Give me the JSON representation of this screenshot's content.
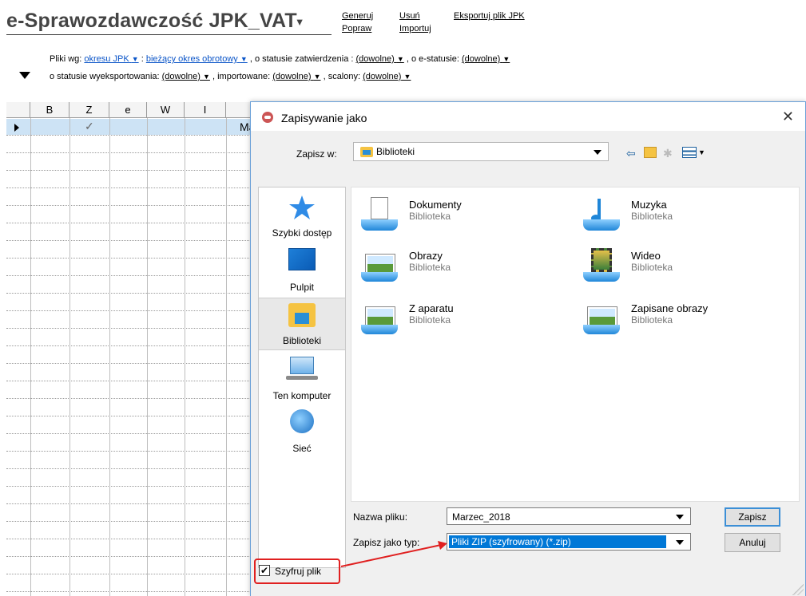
{
  "app": {
    "title": "e-Sprawozdawczość JPK_VAT",
    "title_dropdown": "▾",
    "menu": {
      "generuj": "Generuj",
      "popraw": "Popraw",
      "usun": "Usuń",
      "importuj": "Importuj",
      "eksportuj": "Eksportuj plik JPK"
    }
  },
  "filters": {
    "pliki_wg": "Pliki wg:",
    "okres": "okresu JPK",
    "colon": ":",
    "biezacy": "bieżący okres obrotowy",
    "statusie_zatw": ", o statusie zatwierdzenia :",
    "dowolne1": "(dowolne)",
    "e_status": ", o e-statusie:",
    "dowolne2": "(dowolne)",
    "wyeksportowania": "o statusie wyeksportowania:",
    "dowolne3": "(dowolne)",
    "importowane": ", importowane:",
    "dowolne4": "(dowolne)",
    "scalony": ", scalony:",
    "dowolne5": "(dowolne)",
    "arrow": "▼"
  },
  "grid": {
    "columns": [
      "B",
      "Z",
      "e",
      "W",
      "I"
    ],
    "check": "✓",
    "partial": "Ma"
  },
  "dialog": {
    "title": "Zapisywanie jako",
    "close": "✕",
    "save_in_label": "Zapisz w:",
    "save_in_value": "Biblioteki",
    "places": [
      {
        "label": "Szybki dostęp"
      },
      {
        "label": "Pulpit"
      },
      {
        "label": "Biblioteki"
      },
      {
        "label": "Ten komputer"
      },
      {
        "label": "Sieć"
      }
    ],
    "files": [
      {
        "name": "Dokumenty",
        "type": "Biblioteka"
      },
      {
        "name": "Muzyka",
        "type": "Biblioteka"
      },
      {
        "name": "Obrazy",
        "type": "Biblioteka"
      },
      {
        "name": "Wideo",
        "type": "Biblioteka"
      },
      {
        "name": "Z aparatu",
        "type": "Biblioteka"
      },
      {
        "name": "Zapisane obrazy",
        "type": "Biblioteka"
      }
    ],
    "filename_label": "Nazwa pliku:",
    "filename_value": "Marzec_2018",
    "filetype_label": "Zapisz jako typ:",
    "filetype_value": "Pliki ZIP (szyfrowany) (*.zip)",
    "save_button": "Zapisz",
    "cancel_button": "Anuluj",
    "encrypt_label": "Szyfruj plik",
    "encrypt_checked": "☑"
  },
  "colors": {
    "accent": "#0078d7",
    "highlight": "#e02020",
    "link": "#0b55c8"
  }
}
